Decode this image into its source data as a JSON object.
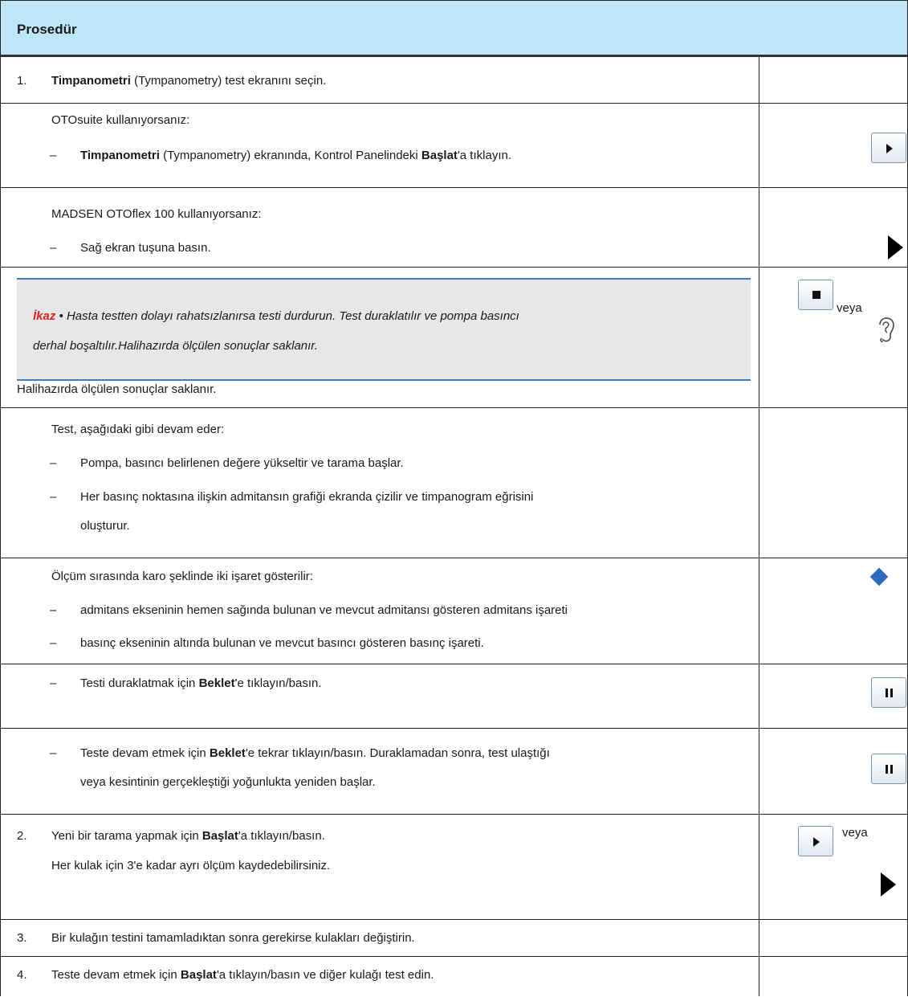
{
  "header": {
    "title": "Prosedür"
  },
  "step1": {
    "num": "1.",
    "bold": "Timpanometri",
    "rest": " (Tympanometry) test ekranını seçin."
  },
  "otosuite": {
    "intro": "OTOsuite kullanıyorsanız:",
    "dash": "–",
    "bold1": "Timpanometri",
    "mid": " (Tympanometry) ekranında, Kontrol Panelindeki ",
    "bold2": "Başlat",
    "end": "'a tıklayın."
  },
  "madsen": {
    "intro": "MADSEN OTOflex 100 kullanıyorsanız:",
    "dash": "–",
    "text": "Sağ ekran tuşuna basın."
  },
  "caution": {
    "label": "İkaz",
    "line1": " • Hasta testten dolayı rahatsızlanırsa testi durdurun. Test duraklatılır ve pompa basıncı",
    "line2": "derhal boşaltılır.Halihazırda ölçülen sonuçlar saklanır.",
    "after": "Halihazırda ölçülen sonuçlar saklanır.",
    "veya": "veya",
    "icons": [
      "stop-button-icon",
      "ear-icon"
    ]
  },
  "continue": {
    "intro": "Test, aşağıdaki gibi devam eder:",
    "dash": "–",
    "item1": "Pompa, basıncı belirlenen değere yükseltir ve tarama başlar.",
    "item2a": "Her basınç noktasına ilişkin admitansın grafiği ekranda çizilir ve timpanogram eğrisini",
    "item2b": "oluşturur."
  },
  "markers": {
    "intro": "Ölçüm sırasında karo şeklinde iki işaret gösterilir:",
    "dash": "–",
    "item1": "admitans ekseninin hemen sağında bulunan ve mevcut admitansı gösteren admitans işareti",
    "item2": "basınç ekseninin altında bulunan ve mevcut basıncı gösteren basınç işareti.",
    "diamond_color": "#2f6bbd"
  },
  "pause": {
    "dash": "–",
    "pre": "Testi duraklatmak için ",
    "bold": "Beklet",
    "post": "'e tıklayın/basın."
  },
  "resume": {
    "dash": "–",
    "pre": "Teste devam etmek için ",
    "bold": "Beklet",
    "post": "'e tekrar tıklayın/basın. Duraklamadan sonra, test ulaştığı",
    "line2": "veya kesintinin gerçekleştiği yoğunlukta yeniden başlar."
  },
  "step2": {
    "num": "2.",
    "pre": "Yeni bir tarama yapmak için ",
    "bold": "Başlat",
    "post": "'a tıklayın/basın.",
    "line2": "Her kulak için 3'e kadar ayrı ölçüm kaydedebilirsiniz.",
    "veya": "veya"
  },
  "step3": {
    "num": "3.",
    "text": "Bir kulağın testini tamamladıktan sonra gerekirse kulakları değiştirin."
  },
  "step4": {
    "num": "4.",
    "pre": "Teste devam etmek için ",
    "bold": "Başlat",
    "post": "'a tıklayın/basın ve diğer kulağı test edin."
  }
}
